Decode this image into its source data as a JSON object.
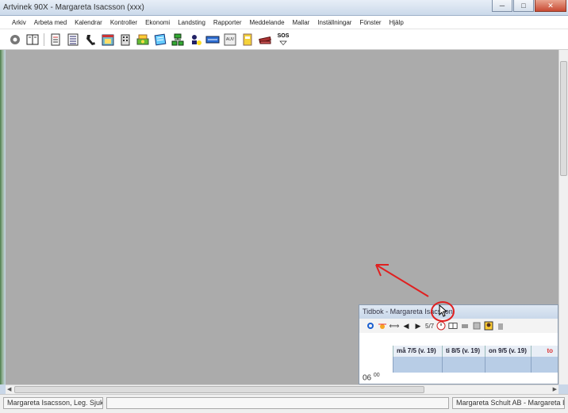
{
  "window": {
    "title": "Artvinek 90X - Margareta Isacsson (xxx)",
    "controls": {
      "minimize": "─",
      "maximize": "□",
      "close": "✕"
    }
  },
  "menu": {
    "items": [
      "Arkiv",
      "Arbeta med",
      "Kalendrar",
      "Kontroller",
      "Ekonomi",
      "Landsting",
      "Rapporter",
      "Meddelande",
      "Mallar",
      "Inställningar",
      "Fönster",
      "Hjälp"
    ]
  },
  "toolbar": {
    "icons": [
      "settings-icon",
      "book-icon",
      "document-icon",
      "list-icon",
      "phone-icon",
      "calendar-icon",
      "building-icon",
      "cash-icon",
      "notes-icon",
      "network-icon",
      "person-icon",
      "blue-bar-icon",
      "calculator-icon",
      "folder-icon",
      "book-stack-icon",
      "sos-icon"
    ],
    "calc_label": "AUV",
    "sos_label": "SOS"
  },
  "child_window": {
    "title": "Tidbok - Margareta Isacsson",
    "page_indicator": "5/7",
    "days": [
      {
        "label": "må 7/5 (v. 19)"
      },
      {
        "label": "ti 8/5 (v. 19)"
      },
      {
        "label": "on 9/5 (v. 19)"
      },
      {
        "label": "to"
      }
    ],
    "time_label": "06",
    "time_minutes": "00"
  },
  "statusbar": {
    "left": "Margareta Isacsson, Leg. Sjukgymnast",
    "right": "Margareta Schult AB - Margareta Isacsson"
  },
  "colors": {
    "workspace": "#ababab",
    "annotation": "#e02020"
  }
}
